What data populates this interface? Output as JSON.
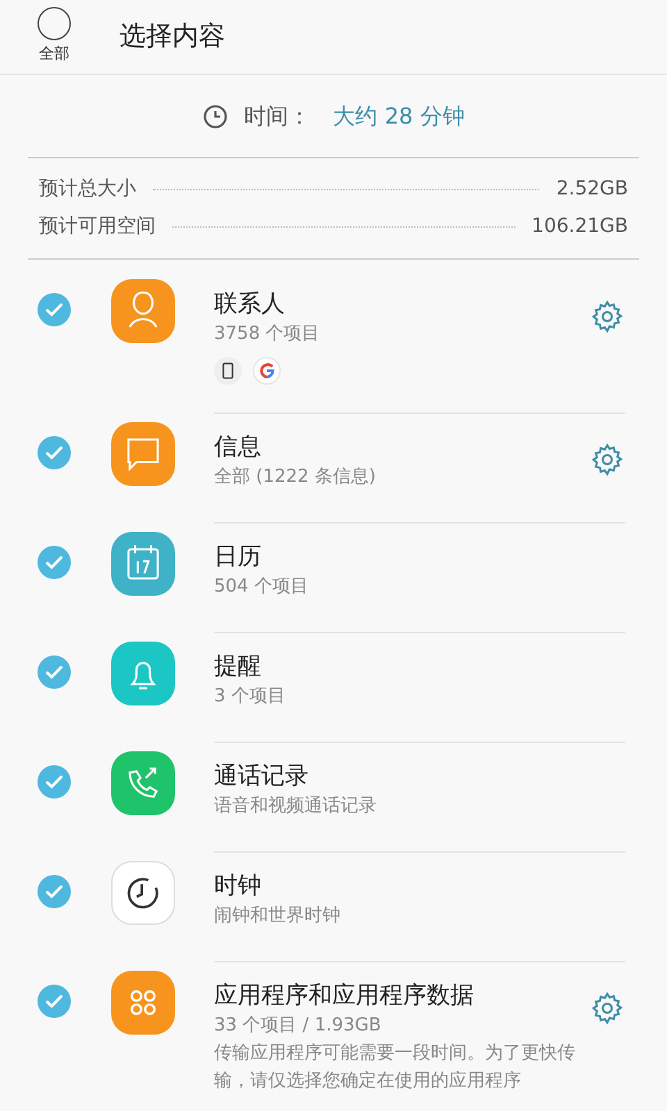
{
  "header": {
    "select_all": {
      "label": "全部",
      "checked": false
    },
    "title": "选择内容"
  },
  "time": {
    "label": "时间：",
    "value": "大约 28 分钟"
  },
  "sizes": [
    {
      "label": "预计总大小",
      "value": "2.52GB"
    },
    {
      "label": "预计可用空间",
      "value": "106.21GB"
    }
  ],
  "items": [
    {
      "kind": "contacts",
      "name": "联系人",
      "detail": "3758 个项目",
      "checked": true,
      "settings": true,
      "sources": [
        {
          "kind": "phone"
        },
        {
          "kind": "google"
        }
      ]
    },
    {
      "kind": "messages",
      "name": "信息",
      "detail": "全部 (1222 条信息)",
      "checked": true,
      "settings": true
    },
    {
      "kind": "calendar",
      "name": "日历",
      "detail": "504 个项目",
      "checked": true,
      "settings": false
    },
    {
      "kind": "reminder",
      "name": "提醒",
      "detail": "3 个项目",
      "checked": true,
      "settings": false
    },
    {
      "kind": "calls",
      "name": "通话记录",
      "detail": "语音和视频通话记录",
      "checked": true,
      "settings": false
    },
    {
      "kind": "clock",
      "name": "时钟",
      "detail": "闹钟和世界时钟",
      "checked": true,
      "settings": false
    },
    {
      "kind": "apps",
      "name": "应用程序和应用程序数据",
      "detail": "33 个项目 / 1.93GB",
      "note": "传输应用程序可能需要一段时间。为了更快传输，请仅选择您确定在使用的应用程序",
      "checked": true,
      "settings": true
    }
  ]
}
